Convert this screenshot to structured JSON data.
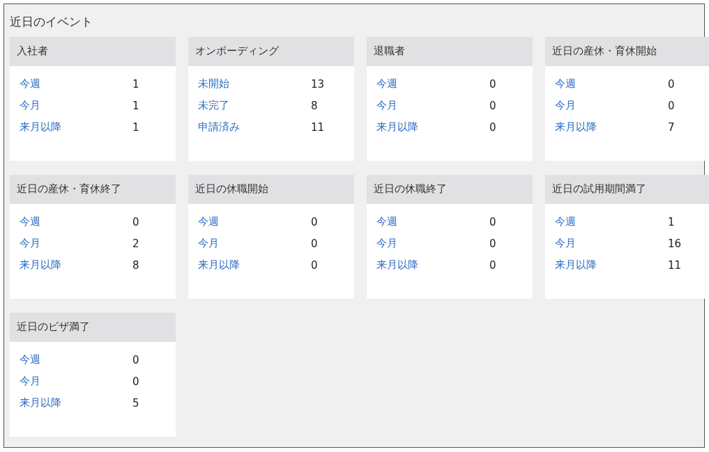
{
  "title": "近日のイベント",
  "cards": [
    {
      "title": "入社者",
      "rows": [
        {
          "label": "今週",
          "value": "1"
        },
        {
          "label": "今月",
          "value": "1"
        },
        {
          "label": "来月以降",
          "value": "1"
        }
      ]
    },
    {
      "title": "オンボーディング",
      "rows": [
        {
          "label": "未開始",
          "value": "13"
        },
        {
          "label": "未完了",
          "value": "8"
        },
        {
          "label": "申請済み",
          "value": "11"
        }
      ]
    },
    {
      "title": "退職者",
      "rows": [
        {
          "label": "今週",
          "value": "0"
        },
        {
          "label": "今月",
          "value": "0"
        },
        {
          "label": "来月以降",
          "value": "0"
        }
      ]
    },
    {
      "title": "近日の産休・育休開始",
      "rows": [
        {
          "label": "今週",
          "value": "0"
        },
        {
          "label": "今月",
          "value": "0"
        },
        {
          "label": "来月以降",
          "value": "7"
        }
      ]
    },
    {
      "title": "近日の産休・育休終了",
      "rows": [
        {
          "label": "今週",
          "value": "0"
        },
        {
          "label": "今月",
          "value": "2"
        },
        {
          "label": "来月以降",
          "value": "8"
        }
      ]
    },
    {
      "title": "近日の休職開始",
      "rows": [
        {
          "label": "今週",
          "value": "0"
        },
        {
          "label": "今月",
          "value": "0"
        },
        {
          "label": "来月以降",
          "value": "0"
        }
      ]
    },
    {
      "title": "近日の休職終了",
      "rows": [
        {
          "label": "今週",
          "value": "0"
        },
        {
          "label": "今月",
          "value": "0"
        },
        {
          "label": "来月以降",
          "value": "0"
        }
      ]
    },
    {
      "title": "近日の試用期間満了",
      "rows": [
        {
          "label": "今週",
          "value": "1"
        },
        {
          "label": "今月",
          "value": "16"
        },
        {
          "label": "来月以降",
          "value": "11"
        }
      ]
    },
    {
      "title": "近日のビザ満了",
      "rows": [
        {
          "label": "今週",
          "value": "0"
        },
        {
          "label": "今月",
          "value": "0"
        },
        {
          "label": "来月以降",
          "value": "5"
        }
      ]
    }
  ]
}
